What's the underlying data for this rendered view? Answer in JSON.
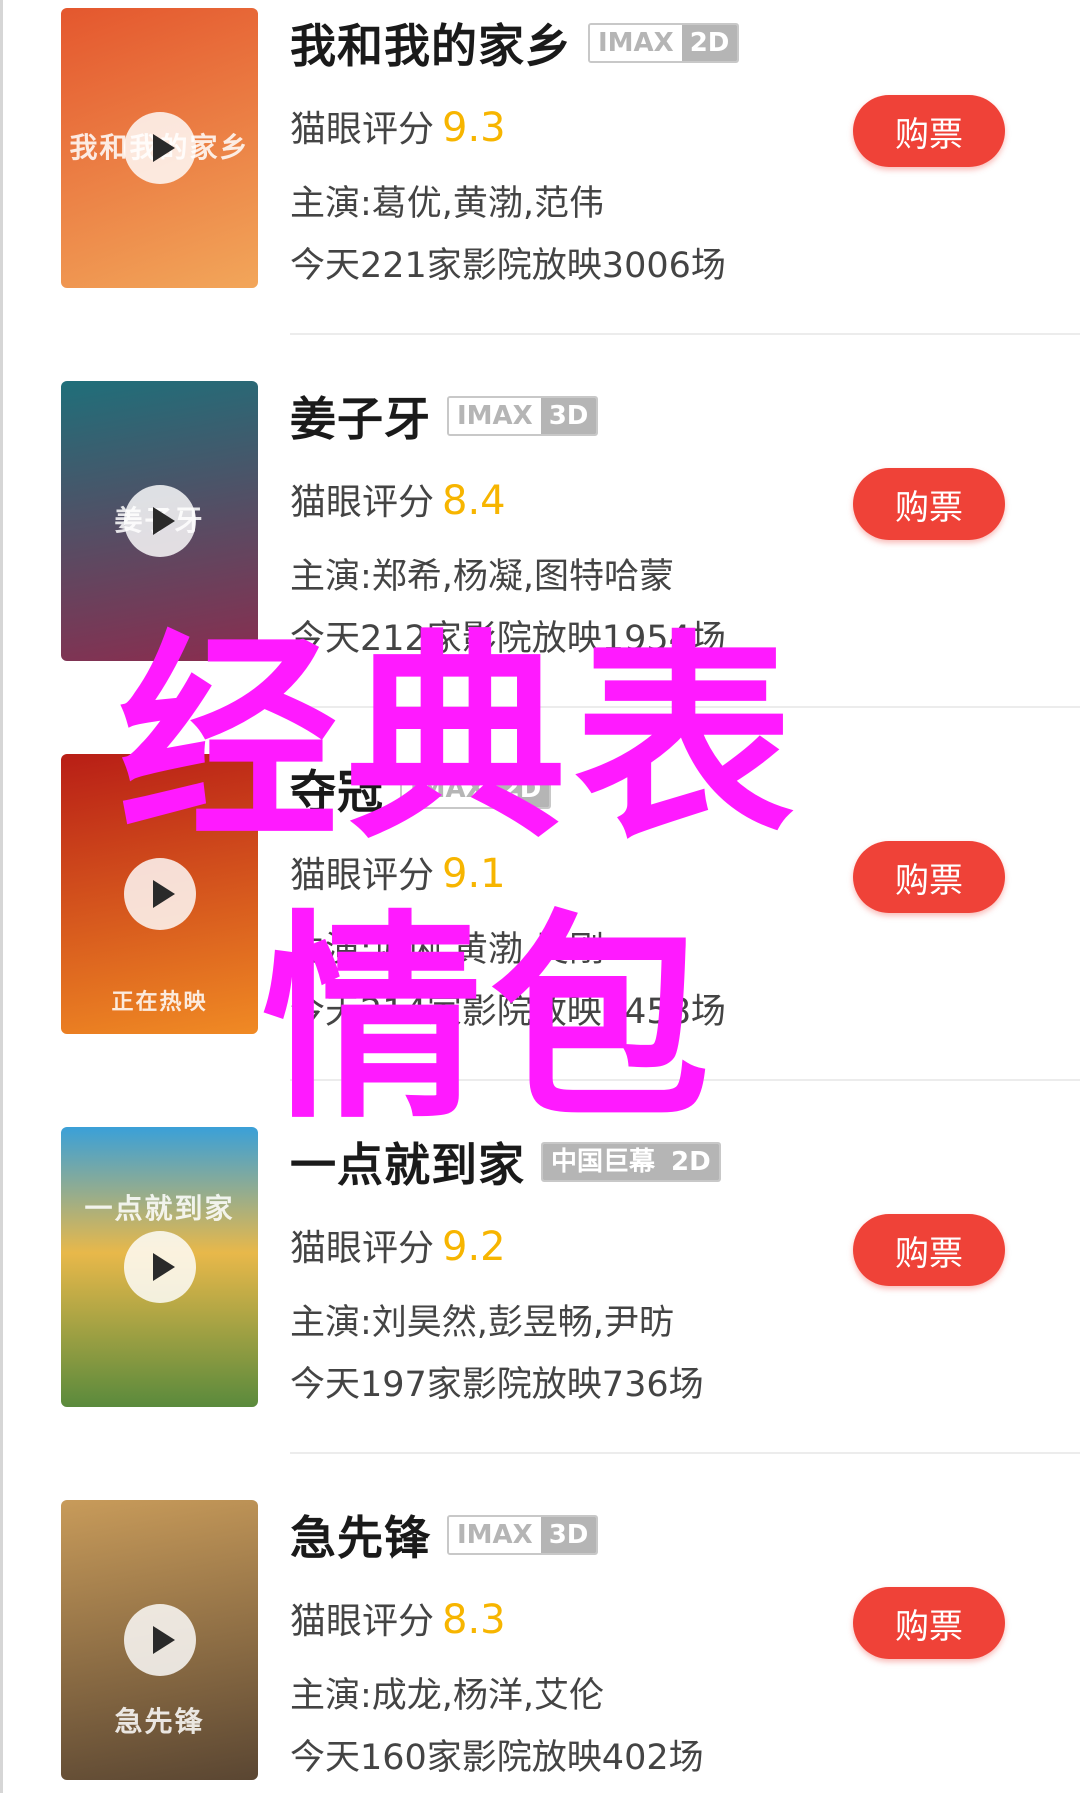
{
  "movies": [
    {
      "title": "我和我的家乡",
      "tag_a": "IMAX",
      "tag_b": "2D",
      "rating_label": "猫眼评分",
      "score": "9.3",
      "actors": "主演:葛优,黄渤,范伟",
      "shows": "今天221家影院放映3006场",
      "buy": "购票",
      "poster_text": "我和我的家乡",
      "poster_colors": [
        "#e4572e",
        "#f2a65a"
      ]
    },
    {
      "title": "姜子牙",
      "tag_a": "IMAX",
      "tag_b": "3D",
      "rating_label": "猫眼评分",
      "score": "8.4",
      "actors": "主演:郑希,杨凝,图特哈蒙",
      "shows": "今天212家影院放映1954场",
      "buy": "购票",
      "poster_text": "姜子牙",
      "poster_colors": [
        "#1f6f7a",
        "#8a2d4f"
      ]
    },
    {
      "title": "夺冠",
      "tag_a": "IMAX",
      "tag_b": "2D",
      "rating_label": "猫眼评分",
      "score": "9.1",
      "actors": "主演:巩俐,黄渤,吴刚",
      "shows": "今天214家影院放映1458场",
      "buy": "购票",
      "poster_text": "正在热映",
      "poster_colors": [
        "#b81e16",
        "#f08a24"
      ]
    },
    {
      "title": "一点就到家",
      "tag_a": "中国巨幕",
      "tag_b": "2D",
      "rating_label": "猫眼评分",
      "score": "9.2",
      "actors": "主演:刘昊然,彭昱畅,尹昉",
      "shows": "今天197家影院放映736场",
      "buy": "购票",
      "poster_text": "一点就到家",
      "poster_colors": [
        "#3aa0d8",
        "#5a8a3c"
      ]
    },
    {
      "title": "急先锋",
      "tag_a": "IMAX",
      "tag_b": "3D",
      "rating_label": "猫眼评分",
      "score": "8.3",
      "actors": "主演:成龙,杨洋,艾伦",
      "shows": "今天160家影院放映402场",
      "buy": "购票",
      "poster_text": "急先锋",
      "poster_colors": [
        "#c89b5a",
        "#5a4632"
      ]
    }
  ],
  "overlay": {
    "line1": "经典表",
    "line2": "情包"
  }
}
